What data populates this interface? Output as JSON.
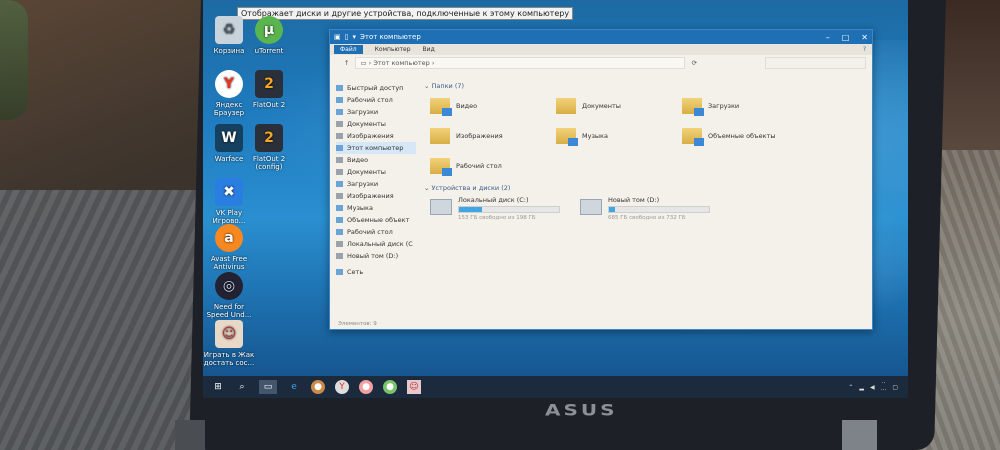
{
  "tooltip": "Отображает диски и другие устройства, подключенные к этому компьютеру",
  "desktop_icons": [
    {
      "label": "Корзина"
    },
    {
      "label": "uTorrent"
    },
    {
      "label": "Яндекс Браузер"
    },
    {
      "label": "FlatOut 2"
    },
    {
      "label": "Warface"
    },
    {
      "label": "FlatOut 2 (config)"
    },
    {
      "label": "VK Play Игрово..."
    },
    {
      "label": "Avast Free Antivirus"
    },
    {
      "label": "Need for Speed Und..."
    },
    {
      "label": "Играть в Жак достать сос..."
    }
  ],
  "window": {
    "title": "Этот компьютер",
    "tabs": [
      "Файл",
      "Компьютер",
      "Вид"
    ],
    "address": "Этот компьютер",
    "nav": [
      {
        "label": "Быстрый доступ"
      },
      {
        "label": "Рабочий стол"
      },
      {
        "label": "Загрузки"
      },
      {
        "label": "Документы"
      },
      {
        "label": "Изображения"
      },
      {
        "label": "Этот компьютер"
      },
      {
        "label": "Видео"
      },
      {
        "label": "Документы"
      },
      {
        "label": "Загрузки"
      },
      {
        "label": "Изображения"
      },
      {
        "label": "Музыка"
      },
      {
        "label": "Объемные объект"
      },
      {
        "label": "Рабочий стол"
      },
      {
        "label": "Локальный диск (C"
      },
      {
        "label": "Новый том (D:)"
      },
      {
        "label": "Сеть"
      }
    ],
    "folders_header": "Папки (7)",
    "folders": [
      {
        "label": "Видео"
      },
      {
        "label": "Документы"
      },
      {
        "label": "Загрузки"
      },
      {
        "label": "Изображения"
      },
      {
        "label": "Музыка"
      },
      {
        "label": "Объемные объекты"
      },
      {
        "label": "Рабочий стол"
      }
    ],
    "drives_header": "Устройства и диски (2)",
    "drives": [
      {
        "label": "Локальный диск (C:)",
        "free": "153 ГБ свободно из 198 ГБ",
        "used_fraction": 0.23
      },
      {
        "label": "Новый том (D:)",
        "free": "685 ГБ свободно из 732 ГБ",
        "used_fraction": 0.06
      }
    ],
    "status": "Элементов: 9"
  },
  "brand": "ASUS"
}
